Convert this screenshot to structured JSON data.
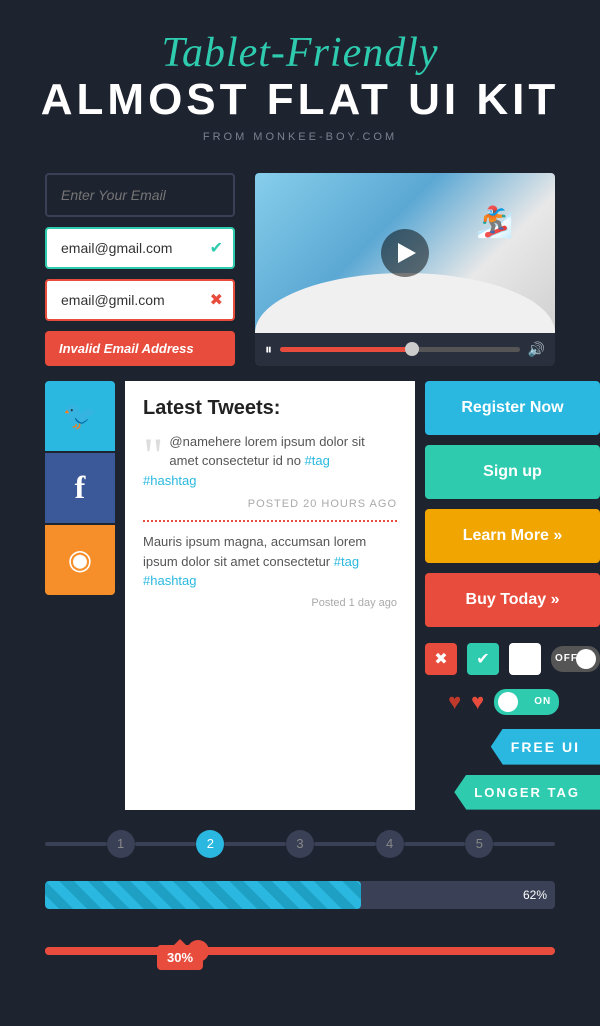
{
  "header": {
    "script_title": "Tablet-Friendly",
    "main_title": "ALMOST FLAT UI KIT",
    "sub_title": "FROM MONKEE-BOY.COM"
  },
  "forms": {
    "placeholder_label": "Enter Your Email",
    "valid_email": "email@gmail.com",
    "invalid_email": "email@gmil.com",
    "error_message": "Invalid Email Address"
  },
  "video": {
    "pause_label": "⏸",
    "volume_label": "🔊"
  },
  "social": {
    "twitter_icon": "🐦",
    "facebook_icon": "f",
    "rss_icon": "◉"
  },
  "tweets": {
    "title": "Latest Tweets:",
    "tweet1_handle": "@namehere",
    "tweet1_text": " lorem ipsum dolor sit amet consectetur id no ",
    "tweet1_tag1": "#tag",
    "tweet1_tag2": "#hashtag",
    "tweet1_time": "POSTED 20 HOURS AGO",
    "tweet2_text": "Mauris ipsum magna, accumsan lorem ipsum dolor sit amet consectetur ",
    "tweet2_tag1": "#tag",
    "tweet2_tag2": "#hashtag",
    "tweet2_time": "Posted 1 day ago"
  },
  "buttons": {
    "register": "Register Now",
    "signup": "Sign up",
    "learn": "Learn More »",
    "buy": "Buy Today »"
  },
  "toggles": {
    "off_label": "OFF",
    "on_label": "ON"
  },
  "pagination": {
    "pages": [
      "1",
      "2",
      "3",
      "4",
      "5"
    ],
    "active": 1
  },
  "progress": {
    "value": "62%"
  },
  "slider": {
    "value": "30%"
  },
  "tags": {
    "free": "FREE UI",
    "longer": "LONGER TAG"
  }
}
